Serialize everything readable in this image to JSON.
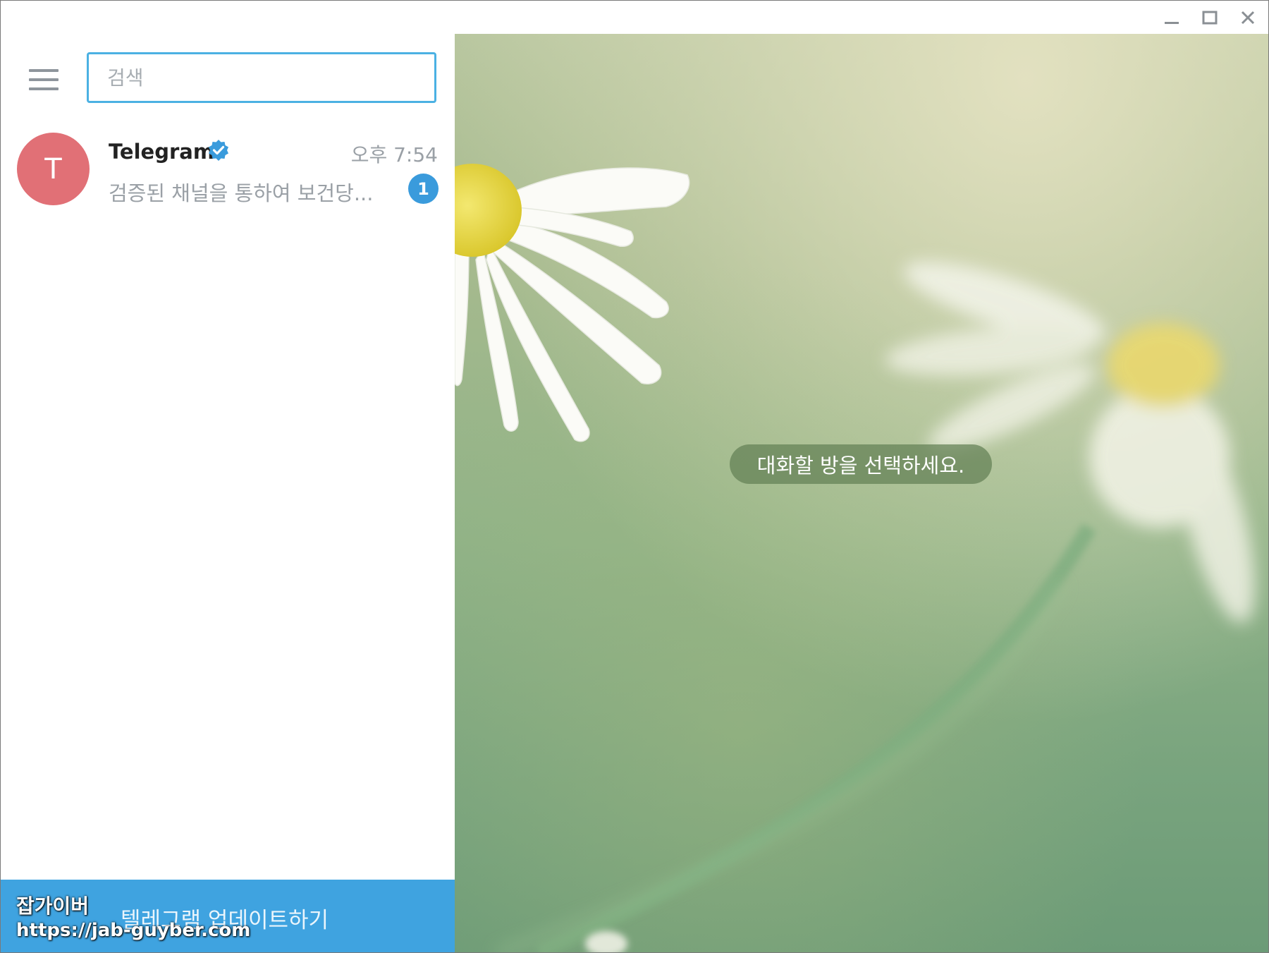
{
  "window": {
    "controls": {
      "minimize_icon": "minimize-icon",
      "maximize_icon": "maximize-icon",
      "close_icon": "close-icon"
    }
  },
  "sidebar": {
    "menu_icon": "hamburger-menu-icon",
    "search": {
      "placeholder": "검색",
      "value": ""
    },
    "chats": [
      {
        "avatar_letter": "T",
        "avatar_color": "#e17076",
        "name": "Telegram",
        "verified": true,
        "time": "오후 7:54",
        "preview": "검증된 채널을 통하여 보건당...",
        "unread": "1"
      }
    ],
    "update_bar": {
      "label": "텔레그램 업데이트하기",
      "color": "#3fa3e0"
    },
    "watermark": {
      "name": "잡가이버",
      "url": "https://jab-guyber.com"
    }
  },
  "main": {
    "empty_message": "대화할 방을 선택하세요."
  },
  "colors": {
    "accent": "#4bb1e3",
    "badge": "#3a9bdc"
  }
}
